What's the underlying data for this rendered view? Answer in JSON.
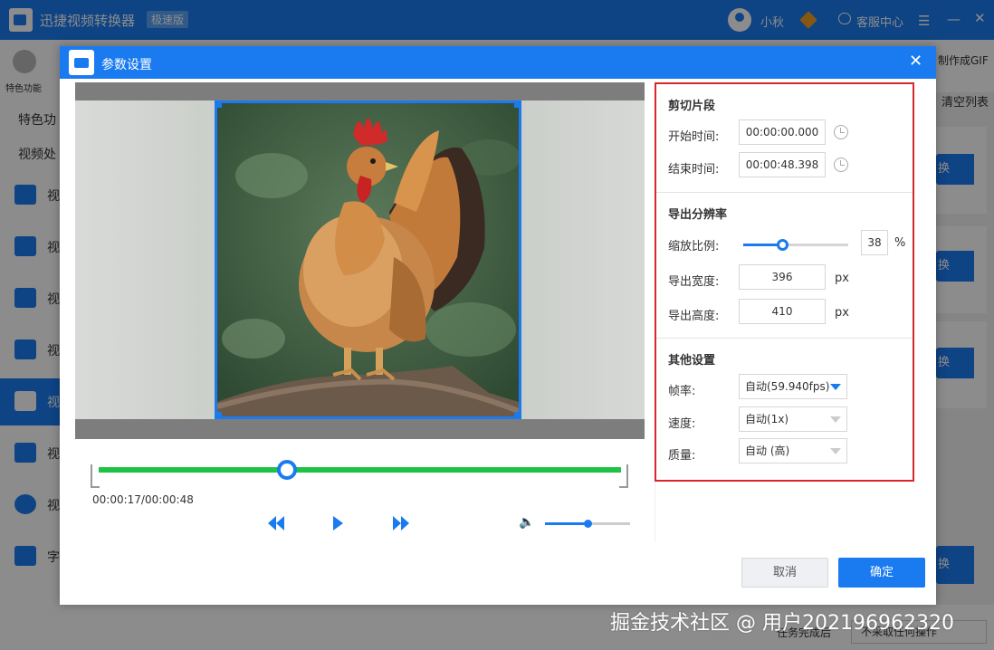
{
  "app": {
    "title": "迅捷视频转换器",
    "edition": "极速版",
    "username": "小秋",
    "service_label": "客服中心",
    "feature_label": "特色功能",
    "gif_tool_label": "制作成GIF",
    "clear_list_label": "清空列表",
    "sidebar": {
      "heading1": "特色功",
      "heading2": "视频处",
      "items": [
        {
          "label": "视"
        },
        {
          "label": "视"
        },
        {
          "label": "视"
        },
        {
          "label": "视"
        },
        {
          "label": "视"
        },
        {
          "label": "视"
        },
        {
          "label": "视"
        },
        {
          "label": "字"
        }
      ]
    },
    "convert_label": "换",
    "footer_text": "任务完成后",
    "footer_select": "不采取任何操作"
  },
  "dialog": {
    "title": "参数设置",
    "close_icon": "close-icon",
    "timeline": {
      "time_readout": "00:00:17/00:00:48",
      "progress": 0.36,
      "volume": 0.5
    },
    "clip": {
      "title": "剪切片段",
      "start_label": "开始时间:",
      "start_value": "00:00:00.000",
      "end_label": "结束时间:",
      "end_value": "00:00:48.398"
    },
    "resolution": {
      "title": "导出分辨率",
      "scale_label": "缩放比例:",
      "scale_value": "38",
      "scale_unit": "%",
      "scale_fraction": 0.38,
      "width_label": "导出宽度:",
      "width_value": "396",
      "height_label": "导出高度:",
      "height_value": "410",
      "px_unit": "px"
    },
    "other": {
      "title": "其他设置",
      "fps_label": "帧率:",
      "fps_value": "自动(59.940fps)",
      "speed_label": "速度:",
      "speed_value": "自动(1x)",
      "quality_label": "质量:",
      "quality_value": "自动 (高)"
    },
    "buttons": {
      "cancel": "取消",
      "ok": "确定"
    }
  },
  "watermark": "掘金技术社区 @ 用户2021969623​20",
  "colors": {
    "accent": "#1a7bf0",
    "track": "#1fc244",
    "highlight_border": "#d9262c"
  }
}
